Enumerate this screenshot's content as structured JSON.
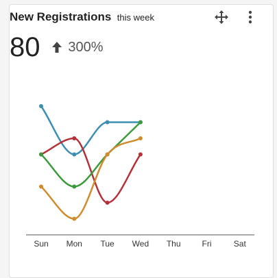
{
  "widget": {
    "title": "New Registrations",
    "subtitle": "this week",
    "move_icon": "move-arrows-icon",
    "menu_icon": "vertical-ellipsis-icon",
    "value": "80",
    "trend_icon": "arrow-up-icon",
    "change": "300%"
  },
  "chart_data": {
    "type": "line",
    "categories": [
      "Sun",
      "Mon",
      "Tue",
      "Wed",
      "Thu",
      "Fri",
      "Sat"
    ],
    "ylim": [
      0,
      10
    ],
    "grid": false,
    "legend": "none",
    "series": [
      {
        "color": "#3d8eb3",
        "values": [
          8,
          5,
          7,
          7
        ]
      },
      {
        "color": "#b3323a",
        "values": [
          5,
          6,
          2,
          5
        ]
      },
      {
        "color": "#3c9a3c",
        "values": [
          5,
          3,
          5,
          7
        ]
      },
      {
        "color": "#cf8c2d",
        "values": [
          3,
          1,
          5,
          6
        ]
      }
    ]
  }
}
